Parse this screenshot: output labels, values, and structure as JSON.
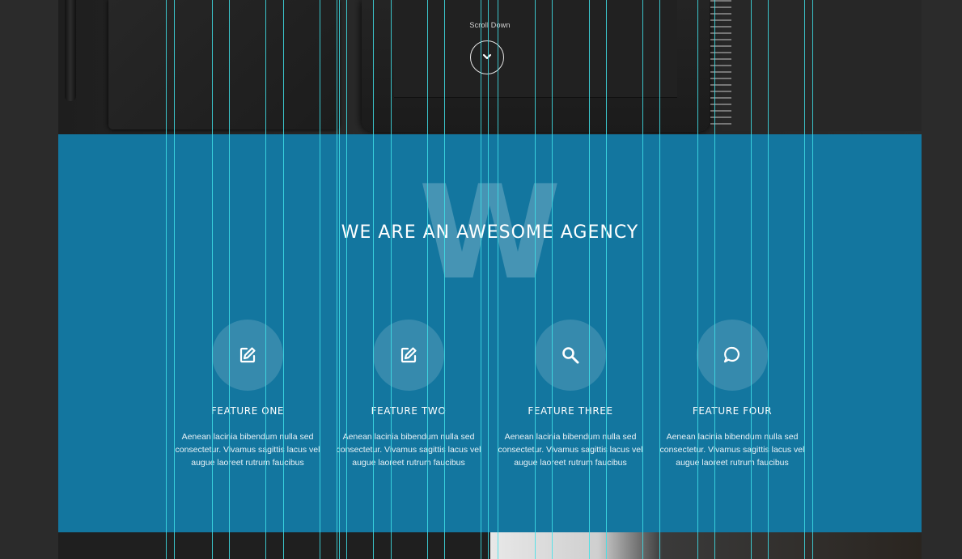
{
  "hero": {
    "scroll_label": "Scroll Down"
  },
  "features_section": {
    "background_letter": "W",
    "title": "WE ARE AN AWESOME AGENCY",
    "accent_color": "#13769f",
    "items": [
      {
        "icon": "pencil-square-icon",
        "title": "FEATURE ONE",
        "text": "Aenean lacinia bibendum nulla sed consectetur. Vivamus sagittis lacus vel augue laoreet rutrum faucibus"
      },
      {
        "icon": "pencil-square-icon",
        "title": "FEATURE TWO",
        "text": "Aenean lacinia bibendum nulla sed consectetur. Vivamus sagittis lacus vel augue laoreet rutrum faucibus"
      },
      {
        "icon": "search-icon",
        "title": "FEATURE THREE",
        "text": "Aenean lacinia bibendum nulla sed consectetur. Vivamus sagittis lacus vel augue laoreet rutrum faucibus"
      },
      {
        "icon": "speech-bubble-icon",
        "title": "FEATURE FOUR",
        "text": "Aenean lacinia bibendum nulla sed consectetur. Vivamus sagittis lacus vel augue laoreet rutrum faucibus"
      }
    ]
  },
  "guides": {
    "color": "#3fe0e8"
  }
}
